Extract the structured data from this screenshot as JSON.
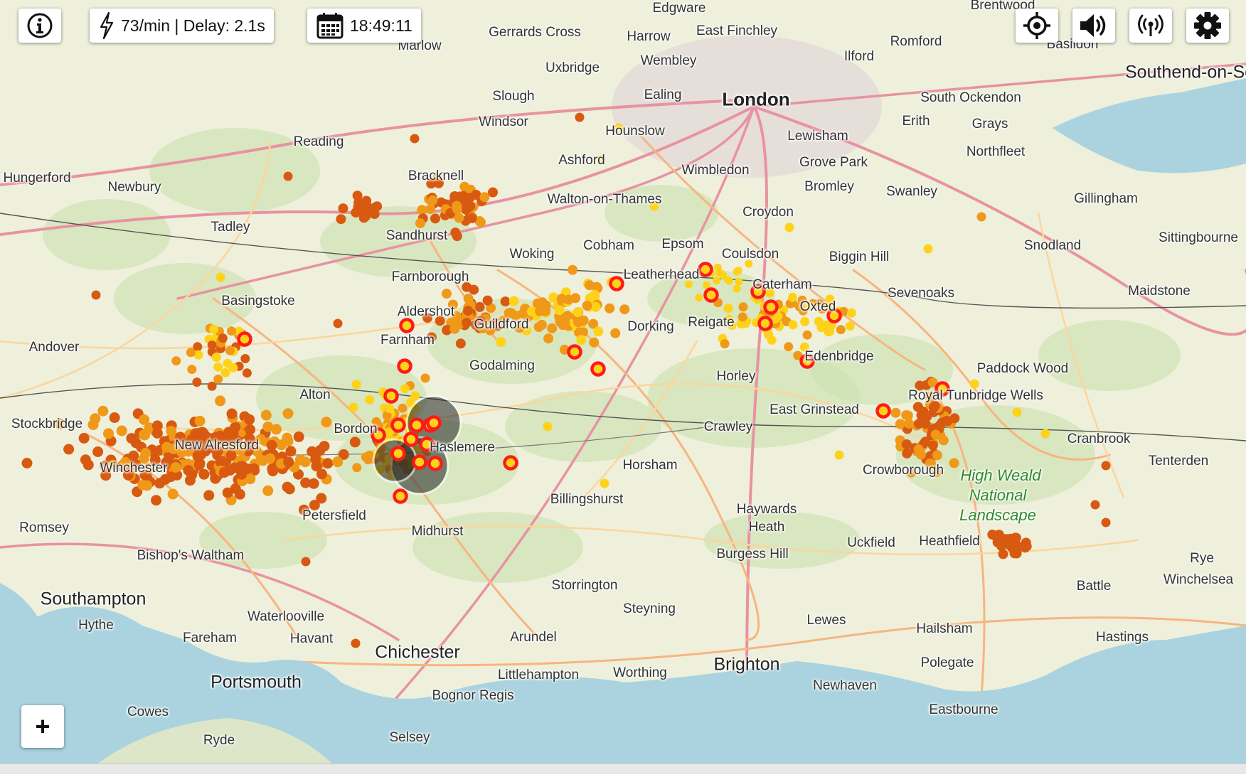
{
  "status": {
    "rate": "73/min | Delay: 2.1s",
    "time": "18:49:11"
  },
  "controls": {
    "info_icon": "info-circle-icon",
    "bolt_icon": "lightning-bolt-icon",
    "calendar_icon": "calendar-icon",
    "locate_icon": "crosshair-locate-icon",
    "sound_icon": "speaker-icon",
    "signal_icon": "antenna-signal-icon",
    "settings_icon": "gear-icon",
    "zoom_in_label": "+"
  },
  "colors": {
    "sea": "#aad3df",
    "land": "#eef0dc",
    "strike_old": "#d85a10",
    "strike_mid": "#f09818",
    "strike_new": "#ffd21a",
    "strike_live": "#ff1a1a"
  },
  "places": [
    {
      "name": "Edgware",
      "type": "town"
    },
    {
      "name": "Brentwood",
      "type": "town"
    },
    {
      "name": "Gerrards Cross",
      "type": "town"
    },
    {
      "name": "Harrow",
      "type": "town"
    },
    {
      "name": "East Finchley",
      "type": "town"
    },
    {
      "name": "Romford",
      "type": "town"
    },
    {
      "name": "Marlow",
      "type": "town"
    },
    {
      "name": "Wembley",
      "type": "town"
    },
    {
      "name": "Ilford",
      "type": "town"
    },
    {
      "name": "Basildon",
      "type": "town"
    },
    {
      "name": "Southend-on-Sea",
      "type": "city"
    },
    {
      "name": "Uxbridge",
      "type": "town"
    },
    {
      "name": "London",
      "type": "big"
    },
    {
      "name": "Slough",
      "type": "town"
    },
    {
      "name": "Ealing",
      "type": "town"
    },
    {
      "name": "South Ockendon",
      "type": "town"
    },
    {
      "name": "Windsor",
      "type": "town"
    },
    {
      "name": "Erith",
      "type": "town"
    },
    {
      "name": "Grays",
      "type": "town"
    },
    {
      "name": "Hounslow",
      "type": "town"
    },
    {
      "name": "Lewisham",
      "type": "town"
    },
    {
      "name": "Reading",
      "type": "town"
    },
    {
      "name": "Northfleet",
      "type": "town"
    },
    {
      "name": "Ashford",
      "type": "town"
    },
    {
      "name": "Grove Park",
      "type": "town"
    },
    {
      "name": "Wimbledon",
      "type": "town"
    },
    {
      "name": "Hungerford",
      "type": "town"
    },
    {
      "name": "Bracknell",
      "type": "town"
    },
    {
      "name": "Newbury",
      "type": "town"
    },
    {
      "name": "Bromley",
      "type": "town"
    },
    {
      "name": "Swanley",
      "type": "town"
    },
    {
      "name": "Walton-on-Thames",
      "type": "town"
    },
    {
      "name": "Gillingham",
      "type": "town"
    },
    {
      "name": "Croydon",
      "type": "town"
    },
    {
      "name": "Tadley",
      "type": "town"
    },
    {
      "name": "Sandhurst",
      "type": "town"
    },
    {
      "name": "Sittingbourne",
      "type": "town"
    },
    {
      "name": "Epsom",
      "type": "town"
    },
    {
      "name": "Cobham",
      "type": "town"
    },
    {
      "name": "Snodland",
      "type": "town"
    },
    {
      "name": "Woking",
      "type": "town"
    },
    {
      "name": "Coulsdon",
      "type": "town"
    },
    {
      "name": "Biggin Hill",
      "type": "town"
    },
    {
      "name": "Farnborough",
      "type": "town"
    },
    {
      "name": "Leatherhead",
      "type": "town"
    },
    {
      "name": "Caterham",
      "type": "town"
    },
    {
      "name": "Maidstone",
      "type": "town"
    },
    {
      "name": "Sevenoaks",
      "type": "town"
    },
    {
      "name": "Basingstoke",
      "type": "town"
    },
    {
      "name": "Oxted",
      "type": "town"
    },
    {
      "name": "Aldershot",
      "type": "town"
    },
    {
      "name": "Reigate",
      "type": "town"
    },
    {
      "name": "Andover",
      "type": "town"
    },
    {
      "name": "Guildford",
      "type": "town"
    },
    {
      "name": "Dorking",
      "type": "town"
    },
    {
      "name": "Farnham",
      "type": "town"
    },
    {
      "name": "Edenbridge",
      "type": "town"
    },
    {
      "name": "Godalming",
      "type": "town"
    },
    {
      "name": "Paddock Wood",
      "type": "town"
    },
    {
      "name": "Horley",
      "type": "town"
    },
    {
      "name": "Alton",
      "type": "town"
    },
    {
      "name": "Royal Tunbridge Wells",
      "type": "town"
    },
    {
      "name": "Stockbridge",
      "type": "town"
    },
    {
      "name": "East Grinstead",
      "type": "town"
    },
    {
      "name": "Crawley",
      "type": "town"
    },
    {
      "name": "Cranbrook",
      "type": "town"
    },
    {
      "name": "Tenterden",
      "type": "town"
    },
    {
      "name": "New Alresford",
      "type": "town"
    },
    {
      "name": "Winchester",
      "type": "town"
    },
    {
      "name": "Haslemere",
      "type": "town"
    },
    {
      "name": "Bordon",
      "type": "town"
    },
    {
      "name": "Horsham",
      "type": "town"
    },
    {
      "name": "Crowborough",
      "type": "town"
    },
    {
      "name": "High Weald",
      "type": "park"
    },
    {
      "name": "National",
      "type": "park"
    },
    {
      "name": "Landscape",
      "type": "park"
    },
    {
      "name": "Billingshurst",
      "type": "town"
    },
    {
      "name": "Haywards",
      "type": "town"
    },
    {
      "name": "Heath",
      "type": "town"
    },
    {
      "name": "Petersfield",
      "type": "town"
    },
    {
      "name": "Romsey",
      "type": "town"
    },
    {
      "name": "Midhurst",
      "type": "town"
    },
    {
      "name": "Uckfield",
      "type": "town"
    },
    {
      "name": "Heathfield",
      "type": "town"
    },
    {
      "name": "Burgess Hill",
      "type": "town"
    },
    {
      "name": "Bishop's Waltham",
      "type": "town"
    },
    {
      "name": "Rye",
      "type": "town"
    },
    {
      "name": "Winchelsea",
      "type": "town"
    },
    {
      "name": "Battle",
      "type": "town"
    },
    {
      "name": "Southampton",
      "type": "city"
    },
    {
      "name": "Storrington",
      "type": "town"
    },
    {
      "name": "Steyning",
      "type": "town"
    },
    {
      "name": "Waterlooville",
      "type": "town"
    },
    {
      "name": "Lewes",
      "type": "town"
    },
    {
      "name": "Hythe",
      "type": "town"
    },
    {
      "name": "Hailsham",
      "type": "town"
    },
    {
      "name": "Fareham",
      "type": "town"
    },
    {
      "name": "Havant",
      "type": "town"
    },
    {
      "name": "Arundel",
      "type": "town"
    },
    {
      "name": "Hastings",
      "type": "town"
    },
    {
      "name": "Chichester",
      "type": "city"
    },
    {
      "name": "Polegate",
      "type": "town"
    },
    {
      "name": "Brighton",
      "type": "city"
    },
    {
      "name": "Portsmouth",
      "type": "city"
    },
    {
      "name": "Littlehampton",
      "type": "town"
    },
    {
      "name": "Worthing",
      "type": "town"
    },
    {
      "name": "Newhaven",
      "type": "town"
    },
    {
      "name": "Bognor Regis",
      "type": "town"
    },
    {
      "name": "Eastbourne",
      "type": "town"
    },
    {
      "name": "Cowes",
      "type": "town"
    },
    {
      "name": "Ryde",
      "type": "town"
    },
    {
      "name": "Selsey",
      "type": "town"
    }
  ]
}
